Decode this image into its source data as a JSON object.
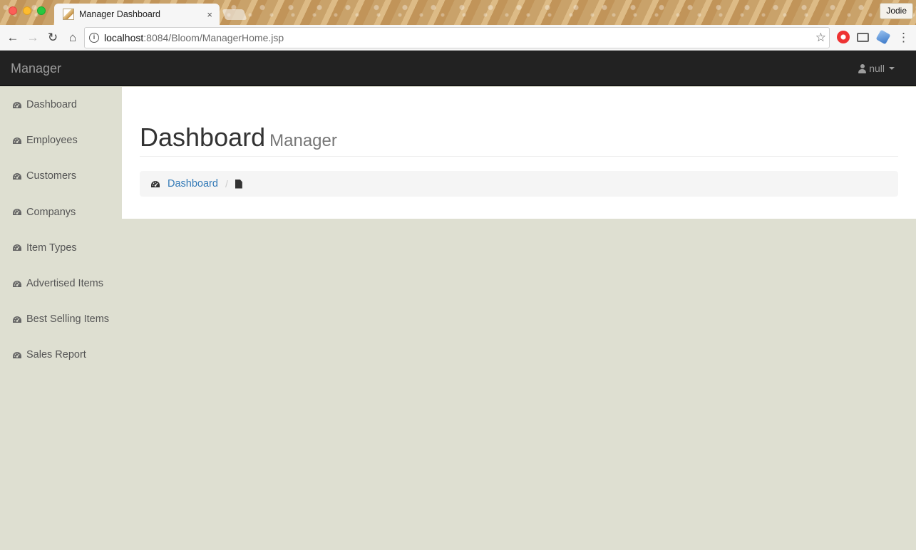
{
  "browser": {
    "tab_title": "Manager Dashboard",
    "tab_close": "×",
    "profile_name": "Jodie",
    "url_host": "localhost",
    "url_rest": ":8084/Bloom/ManagerHome.jsp",
    "nav": {
      "back": "←",
      "forward": "→",
      "reload": "↻",
      "home": "⌂",
      "star": "☆",
      "menu": "⋮",
      "info": "i"
    }
  },
  "app": {
    "brand": "Manager",
    "user_label": "null"
  },
  "sidebar": {
    "items": [
      {
        "label": "Dashboard",
        "icon": "dashboard-icon"
      },
      {
        "label": "Employees",
        "icon": "dashboard-icon"
      },
      {
        "label": "Customers",
        "icon": "dashboard-icon"
      },
      {
        "label": "Companys",
        "icon": "dashboard-icon"
      },
      {
        "label": "Item Types",
        "icon": "dashboard-icon"
      },
      {
        "label": "Advertised Items",
        "icon": "dashboard-icon"
      },
      {
        "label": "Best Selling Items",
        "icon": "dashboard-icon"
      },
      {
        "label": "Sales Report",
        "icon": "dashboard-icon"
      }
    ]
  },
  "main": {
    "title": "Dashboard",
    "subtitle": "Manager",
    "breadcrumb": {
      "link": "Dashboard",
      "separator": "/"
    }
  },
  "colors": {
    "navbar_bg": "#222222",
    "sidebar_bg": "#dedfd1",
    "link": "#337ab7"
  }
}
